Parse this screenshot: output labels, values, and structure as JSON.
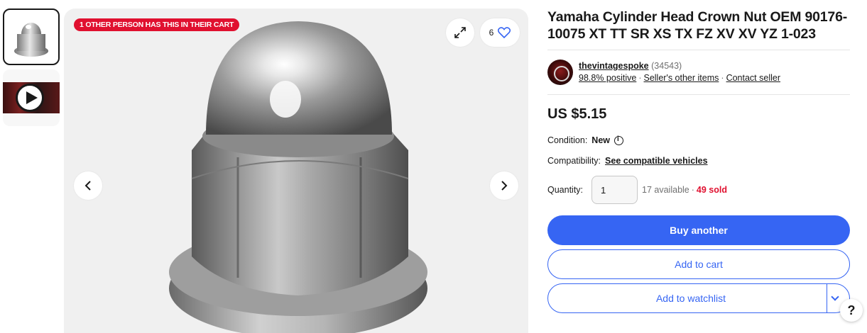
{
  "gallery": {
    "badge": "1 OTHER PERSON HAS THIS IN THEIR CART",
    "watchers": "6"
  },
  "listing": {
    "title": "Yamaha Cylinder Head Crown Nut OEM 90176-10075 XT TT SR XS TX FZ XV XV YZ 1-023",
    "price": "US $5.15"
  },
  "seller": {
    "name": "thevintagespoke",
    "feedback_count": "(34543)",
    "positive": "98.8% positive",
    "other_items": "Seller's other items",
    "contact": "Contact seller"
  },
  "details": {
    "condition_label": "Condition:",
    "condition_value": "New",
    "compat_label": "Compatibility:",
    "compat_link": "See compatible vehicles",
    "quantity_label": "Quantity:",
    "quantity_value": "1",
    "available": "17 available",
    "sold": "49 sold"
  },
  "actions": {
    "buy": "Buy another",
    "cart": "Add to cart",
    "watch": "Add to watchlist"
  },
  "help": "?",
  "colors": {
    "primary": "#3665f3",
    "badge_red": "#e0102f",
    "text": "#191919"
  }
}
